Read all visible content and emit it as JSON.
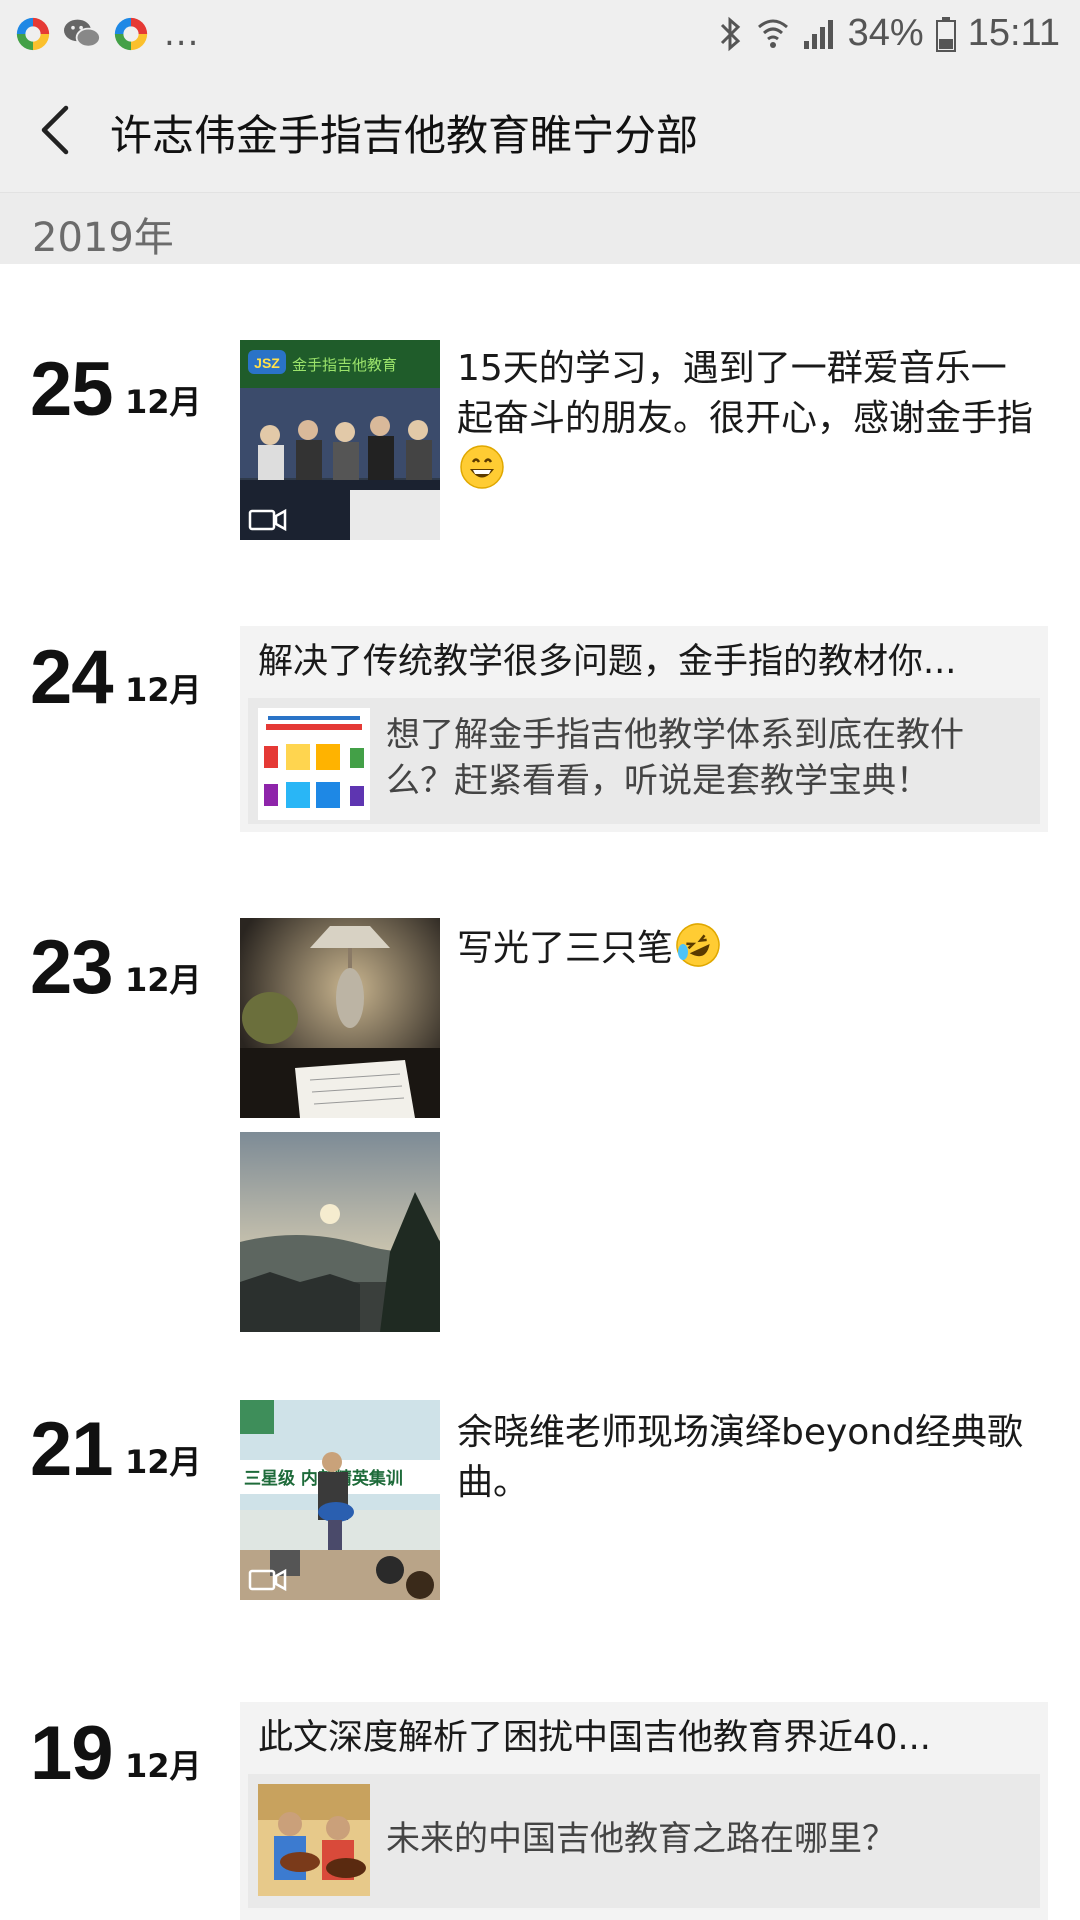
{
  "status_bar": {
    "dots": "...",
    "battery_percent": "34%",
    "time": "15:11"
  },
  "header": {
    "title": "许志伟金手指吉他教育睢宁分部"
  },
  "timeline": {
    "year": "2019年",
    "entries": [
      {
        "day": "25",
        "month": "12月",
        "text": "15天的学习，遇到了一群爱音乐一起奋斗的朋友。很开心，感谢金手指",
        "thumb_caption": "金手指吉他教育",
        "thumb_logo": "JSZ",
        "has_video": true,
        "emoji": "grinning-face"
      },
      {
        "day": "24",
        "month": "12月",
        "share_title": "解决了传统教学很多问题，金手指的教材你...",
        "share_desc": "想了解金手指吉他教学体系到底在教什么？赶紧看看，听说是套教学宝典！"
      },
      {
        "day": "23",
        "month": "12月",
        "text": "写光了三只笔",
        "emoji": "rolling-laughing-face"
      },
      {
        "day": "21",
        "month": "12月",
        "text": "余晓维老师现场演绎beyond经典歌曲。",
        "thumb_caption": "三星级 内部精英集训",
        "has_video": true
      },
      {
        "day": "19",
        "month": "12月",
        "share_title": "此文深度解析了困扰中国吉他教育界近40...",
        "share_desc": "未来的中国吉他教育之路在哪里？"
      }
    ]
  },
  "colors": {
    "bar_bg": "#efefef",
    "year_bg": "#ececec",
    "card_bg": "#f3f3f3",
    "card_inner_bg": "#e9e9e9"
  }
}
